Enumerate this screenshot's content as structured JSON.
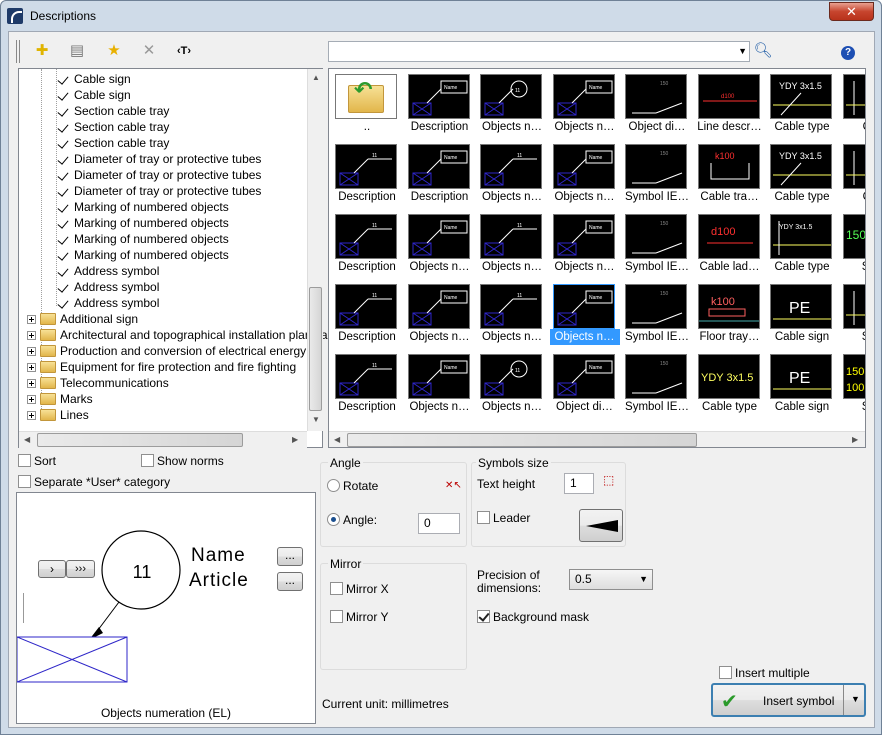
{
  "window": {
    "title": "Descriptions",
    "close": "✕"
  },
  "toolbar": {
    "text_tool_label": "‹T›",
    "search_value": ""
  },
  "tree": {
    "children": [
      "Cable sign",
      "Cable sign",
      "Section cable tray",
      "Section cable tray",
      "Section cable tray",
      "Diameter of tray or protective tubes",
      "Diameter of tray or protective tubes",
      "Diameter of tray or protective tubes",
      "Marking of numbered objects",
      "Marking of numbered objects",
      "Marking of numbered objects",
      "Marking of numbered objects",
      "Address symbol",
      "Address symbol",
      "Address symbol"
    ],
    "folders": [
      "Additional sign",
      "Architectural and topographical installation plans a",
      "Production and conversion of electrical energy",
      "Equipment for fire protection and fire fighting",
      "Telecommunications",
      "Marks",
      "Lines"
    ]
  },
  "gallery": {
    "rows": [
      [
        "..",
        "Description",
        "Objects n…",
        "Objects n…",
        "Object di…",
        "Line descr…",
        "Cable type",
        "Cabl"
      ],
      [
        "Description",
        "Description",
        "Objects n…",
        "Objects n…",
        "Symbol IE…",
        "Cable tra…",
        "Cable type",
        "Cabl"
      ],
      [
        "Description",
        "Objects n…",
        "Objects n…",
        "Objects n…",
        "Symbol IE…",
        "Cable lad…",
        "Cable type",
        "Secti"
      ],
      [
        "Description",
        "Objects n…",
        "Objects n…",
        "Objects n…",
        "Symbol IE…",
        "Floor tray…",
        "Cable sign",
        "Secti"
      ],
      [
        "Description",
        "Objects n…",
        "Objects n…",
        "Object di…",
        "Symbol IE…",
        "Cable type",
        "Cable sign",
        "Secti"
      ]
    ],
    "selected": "3-3",
    "pic_texts": {
      "ydy": "YDY 3x1.5",
      "ydy2": "YDY 3x1.5",
      "k100": "k100",
      "d100": "d100",
      "pe": "PE",
      "n150": "150",
      "n11": "11",
      "name": "Name",
      "n1500": "150",
      "n100": "100"
    }
  },
  "options": {
    "sort": "Sort",
    "show_norms": "Show norms",
    "separate_user": "Separate *User* category"
  },
  "preview": {
    "number": "11",
    "name": "Name",
    "article": "Article",
    "caption": "Objects numeration (EL)",
    "btn_next": "›",
    "btn_last": "›››",
    "btn_more1": "...",
    "btn_more2": "..."
  },
  "angle": {
    "title": "Angle",
    "rotate": "Rotate",
    "angle_label": "Angle:",
    "angle_value": "0"
  },
  "mirror": {
    "title": "Mirror",
    "x": "Mirror X",
    "y": "Mirror Y"
  },
  "symbols_size": {
    "title": "Symbols size",
    "text_height_label": "Text height",
    "text_height_value": "1",
    "leader": "Leader"
  },
  "precision": {
    "label_line1": "Precision of",
    "label_line2": "dimensions:",
    "value": "0.5"
  },
  "background_mask": "Background mask",
  "current_unit": "Current unit: millimetres",
  "insert_multiple": "Insert multiple",
  "insert_symbol": "Insert symbol",
  "colors": {
    "accent": "#3399ff",
    "symbol_blue": "#2e26c8",
    "titlebar": "#cfdbe8"
  }
}
